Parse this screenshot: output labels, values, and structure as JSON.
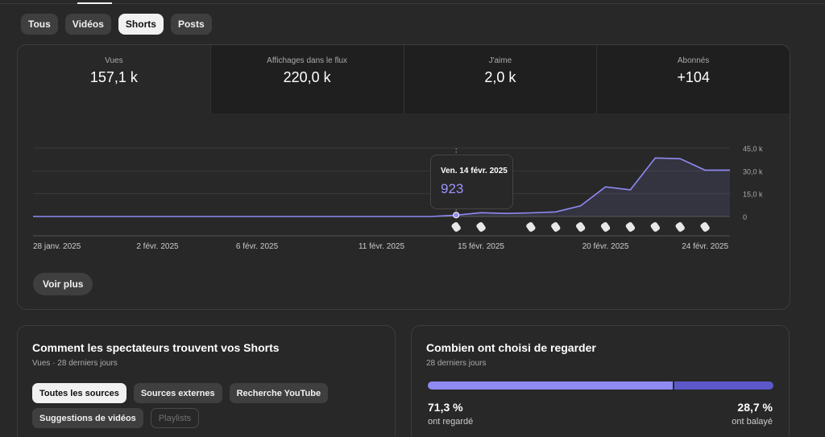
{
  "tabs": [
    {
      "label": "Tous",
      "active": false
    },
    {
      "label": "Vidéos",
      "active": false
    },
    {
      "label": "Shorts",
      "active": true
    },
    {
      "label": "Posts",
      "active": false
    }
  ],
  "metrics": [
    {
      "label": "Vues",
      "value": "157,1 k"
    },
    {
      "label": "Affichages dans le flux",
      "value": "220,0 k"
    },
    {
      "label": "J'aime",
      "value": "2,0 k"
    },
    {
      "label": "Abonnés",
      "value": "+104"
    }
  ],
  "chart_data": {
    "type": "line",
    "x_start": "28 janv. 2025",
    "x": [
      "28 janv.",
      "29 janv.",
      "30 janv.",
      "31 janv.",
      "1 févr.",
      "2 févr.",
      "3 févr.",
      "4 févr.",
      "5 févr.",
      "6 févr.",
      "7 févr.",
      "8 févr.",
      "9 févr.",
      "10 févr.",
      "11 févr.",
      "12 févr.",
      "13 févr.",
      "14 févr.",
      "15 févr.",
      "16 févr.",
      "17 févr.",
      "18 févr.",
      "19 févr.",
      "20 févr.",
      "21 févr.",
      "22 févr.",
      "23 févr.",
      "24 févr.",
      "25 févr."
    ],
    "values": [
      0,
      0,
      0,
      0,
      0,
      0,
      0,
      0,
      0,
      0,
      0,
      0,
      0,
      0,
      0,
      0,
      0,
      923,
      2500,
      2000,
      2400,
      3000,
      7000,
      19500,
      17500,
      38500,
      38000,
      30500,
      30500
    ],
    "x_tick_labels": [
      {
        "index": 0,
        "label": "28 janv. 2025"
      },
      {
        "index": 5,
        "label": "2 févr. 2025"
      },
      {
        "index": 9,
        "label": "6 févr. 2025"
      },
      {
        "index": 14,
        "label": "11 févr. 2025"
      },
      {
        "index": 18,
        "label": "15 févr. 2025"
      },
      {
        "index": 23,
        "label": "20 févr. 2025"
      },
      {
        "index": 27,
        "label": "24 févr. 2025"
      }
    ],
    "y_ticks": [
      {
        "value": 0,
        "label": "0"
      },
      {
        "value": 15000,
        "label": "15,0 k"
      },
      {
        "value": 30000,
        "label": "30,0 k"
      },
      {
        "value": 45000,
        "label": "45,0 k"
      }
    ],
    "ylim": [
      0,
      45000
    ],
    "publish_marker_indices": [
      17,
      18,
      20,
      21,
      22,
      23,
      24,
      25,
      26,
      27
    ],
    "highlight_index": 17,
    "series_color": "#8f8af4"
  },
  "tooltip": {
    "date": "Ven. 14 févr. 2025",
    "value": "923"
  },
  "see_more": "Voir plus",
  "left_card": {
    "title": "Comment les spectateurs trouvent vos Shorts",
    "subtitle": "Vues · 28 derniers jours",
    "sources": [
      {
        "label": "Toutes les sources",
        "state": "active"
      },
      {
        "label": "Sources externes",
        "state": "normal"
      },
      {
        "label": "Recherche YouTube",
        "state": "normal"
      },
      {
        "label": "Suggestions de vidéos",
        "state": "normal"
      },
      {
        "label": "Playlists",
        "state": "disabled"
      }
    ]
  },
  "right_card": {
    "title": "Combien ont choisi de regarder",
    "subtitle": "28 derniers jours",
    "watched_pct": "71,3 %",
    "watched_label": "ont regardé",
    "watched_fraction": 0.713,
    "swiped_pct": "28,7 %",
    "swiped_label": "ont balayé",
    "watched_color": "#8f8af4",
    "swiped_color": "#5c58c9"
  }
}
